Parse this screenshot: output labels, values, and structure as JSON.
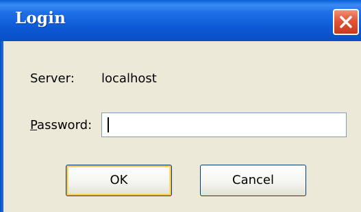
{
  "window": {
    "title": "Login"
  },
  "form": {
    "server_label": "Server:",
    "server_value": "localhost",
    "password_label_underlined": "P",
    "password_label_rest": "assword:",
    "password_value": ""
  },
  "buttons": {
    "ok_label": "OK",
    "cancel_label": "Cancel"
  },
  "icons": {
    "close": "close-icon"
  },
  "colors": {
    "titlebar": "#0c58d4",
    "close_button": "#e2543a",
    "dialog_background": "#ece9d8",
    "default_button_highlight": "#f0c54a"
  }
}
